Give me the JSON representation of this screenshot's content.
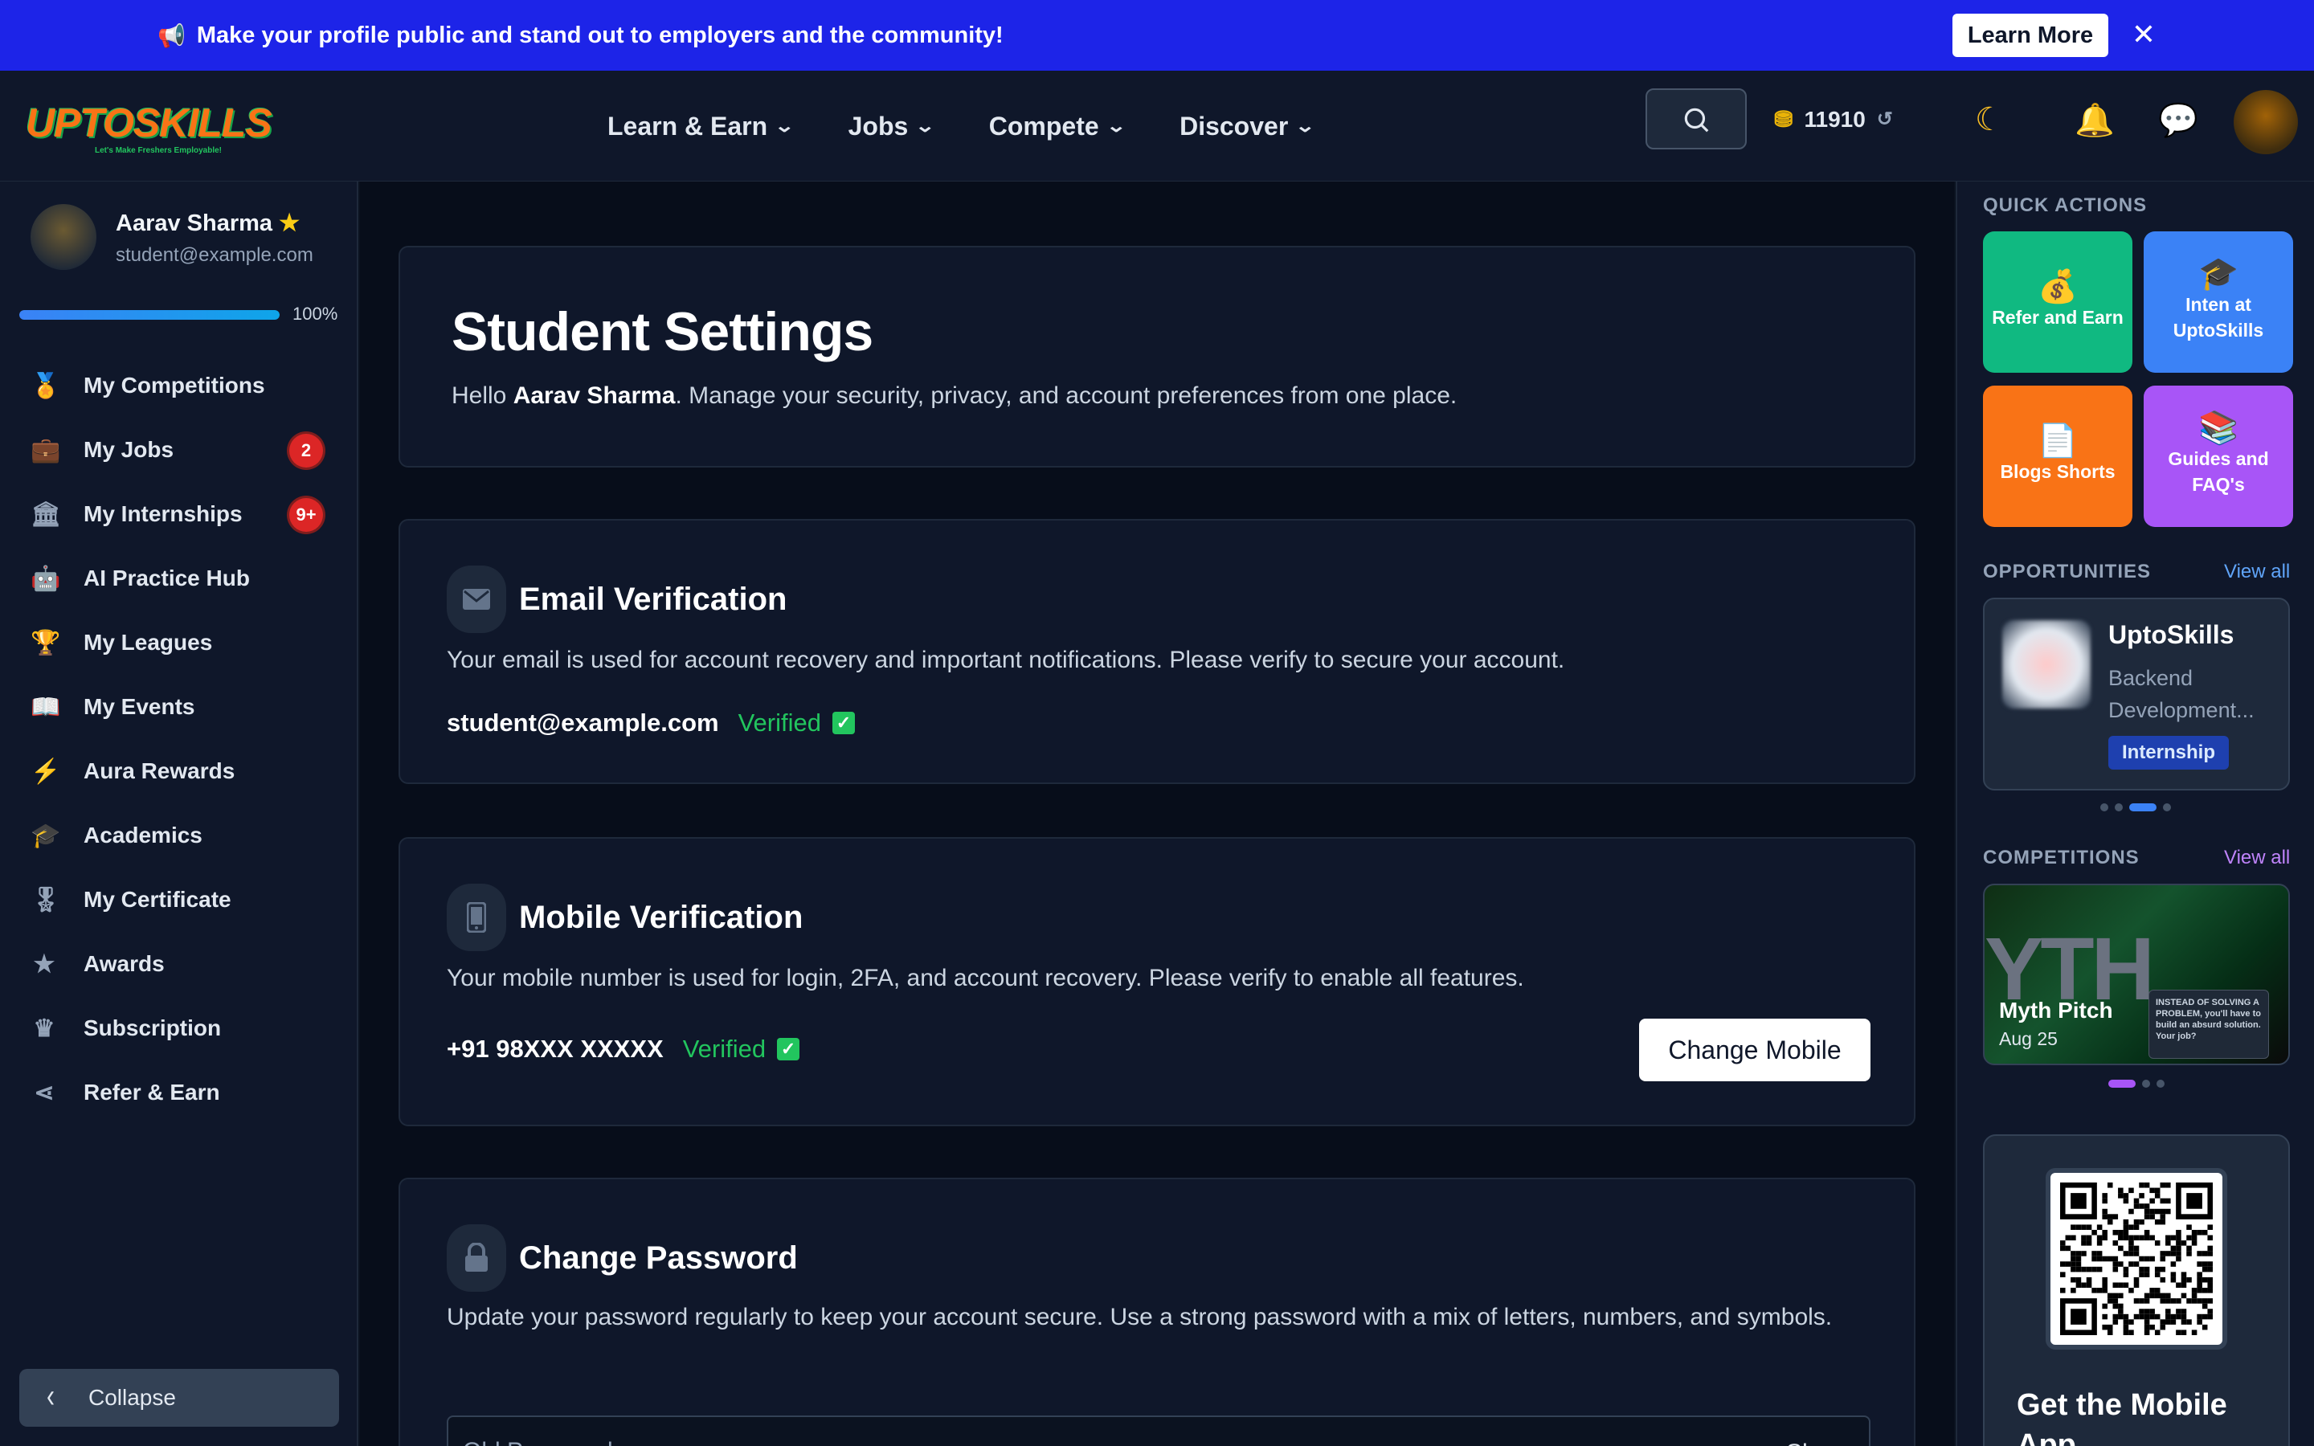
{
  "banner": {
    "text": "Make your profile public and stand out to employers and the community!",
    "learn_more": "Learn More",
    "close": "✕"
  },
  "header": {
    "logo_text": "UPTOSKILLS",
    "logo_tagline": "Let's Make Freshers Employable!",
    "nav": [
      {
        "label": "Learn & Earn"
      },
      {
        "label": "Jobs"
      },
      {
        "label": "Compete"
      },
      {
        "label": "Discover"
      }
    ],
    "coins": "11910"
  },
  "sidebar": {
    "user_name": "Aarav Sharma",
    "user_email": "student@example.com",
    "progress": 100,
    "progress_label": "100%",
    "items": [
      {
        "label": "My Competitions",
        "icon": "medal-icon"
      },
      {
        "label": "My Jobs",
        "icon": "briefcase-icon",
        "badge": "2"
      },
      {
        "label": "My Internships",
        "icon": "building-icon",
        "badge": "9+"
      },
      {
        "label": "AI Practice Hub",
        "icon": "robot-icon"
      },
      {
        "label": "My Leagues",
        "icon": "trophy-icon"
      },
      {
        "label": "My Events",
        "icon": "book-icon"
      },
      {
        "label": "Aura Rewards",
        "icon": "bolt-icon"
      },
      {
        "label": "Academics",
        "icon": "graduation-cap-icon"
      },
      {
        "label": "My Certificate",
        "icon": "certificate-icon"
      },
      {
        "label": "Awards",
        "icon": "star-icon"
      },
      {
        "label": "Subscription",
        "icon": "crown-icon"
      },
      {
        "label": "Refer & Earn",
        "icon": "share-icon"
      }
    ],
    "collapse_label": "Collapse"
  },
  "main": {
    "title": "Student Settings",
    "greeting_prefix": "Hello ",
    "greeting_name": "Aarav Sharma",
    "greeting_suffix": ". Manage your security, privacy, and account preferences from one place.",
    "email": {
      "title": "Email Verification",
      "description": "Your email is used for account recovery and important notifications. Please verify to secure your account.",
      "value": "student@example.com",
      "status": "Verified"
    },
    "mobile": {
      "title": "Mobile Verification",
      "description": "Your mobile number is used for login, 2FA, and account recovery. Please verify to enable all features.",
      "value": "+91 98XXX XXXXX",
      "status": "Verified",
      "button": "Change Mobile"
    },
    "password": {
      "title": "Change Password",
      "description": "Update your password regularly to keep your account secure. Use a strong password with a mix of letters, numbers, and symbols.",
      "old_placeholder": "Old Password",
      "show": "Show"
    }
  },
  "right": {
    "quick_actions_title": "QUICK ACTIONS",
    "quick_actions": [
      {
        "label": "Refer and Earn",
        "color": "#10b981"
      },
      {
        "label": "Inten at UptoSkills",
        "color": "#3b82f6"
      },
      {
        "label": "Blogs Shorts",
        "color": "#f97316"
      },
      {
        "label": "Guides and FAQ's",
        "color": "#a855f7"
      }
    ],
    "opportunities_title": "OPPORTUNITIES",
    "view_all": "View all",
    "opportunity": {
      "company": "UptoSkills",
      "role": "Backend Development...",
      "tag": "Internship"
    },
    "competitions_title": "COMPETITIONS",
    "competition": {
      "title": "Myth Pitch",
      "date": "Aug 25",
      "art_text": "YTH",
      "inset_text": "INSTEAD OF SOLVING A PROBLEM, you'll have to build an absurd solution. Your job?"
    },
    "app_title": "Get the Mobile App"
  }
}
